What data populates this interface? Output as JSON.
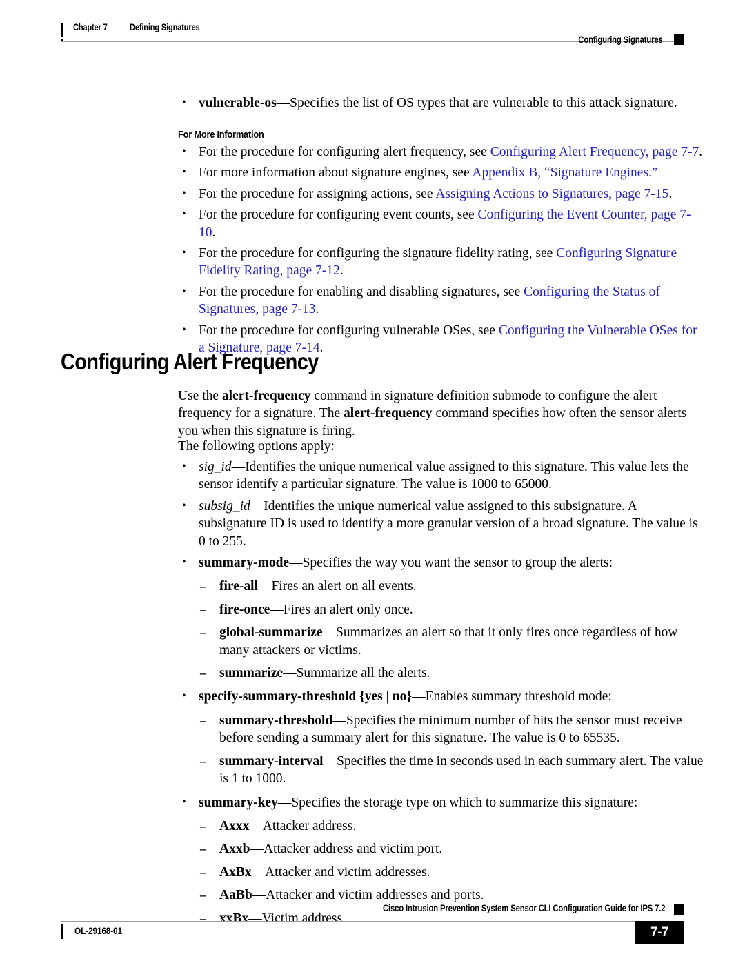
{
  "header": {
    "chapter_label": "Chapter 7",
    "chapter_title": "Defining Signatures",
    "section_label": "Configuring Signatures"
  },
  "footer": {
    "guide_title": "Cisco Intrusion Prevention System Sensor CLI Configuration Guide for IPS 7.2",
    "doc_id": "OL-29168-01",
    "page_number": "7-7"
  },
  "body": {
    "intro_bullet": {
      "term": "vulnerable-os",
      "text": "—Specifies the list of OS types that are vulnerable to this attack signature."
    },
    "for_more_information_heading": "For More Information",
    "for_more_information": [
      {
        "lead": "For the procedure for configuring alert frequency, see ",
        "link": "Configuring Alert Frequency, page 7-7",
        "tail": "."
      },
      {
        "lead": "For more information about signature engines, see ",
        "link": "Appendix B, “Signature Engines.”",
        "tail": ""
      },
      {
        "lead": "For the procedure for assigning actions, see ",
        "link": "Assigning Actions to Signatures, page 7-15",
        "tail": "."
      },
      {
        "lead": "For the procedure for configuring event counts, see ",
        "link": "Configuring the Event Counter, page 7-10",
        "tail": "."
      },
      {
        "lead": "For the procedure for configuring the signature fidelity rating, see ",
        "link": "Configuring Signature Fidelity Rating, page 7-12",
        "tail": "."
      },
      {
        "lead": "For the procedure for enabling and disabling signatures, see ",
        "link": "Configuring the Status of Signatures, page 7-13",
        "tail": "."
      },
      {
        "lead": "For the procedure for configuring vulnerable OSes, see ",
        "link": "Configuring the Vulnerable OSes for a Signature, page 7-14",
        "tail": "."
      }
    ],
    "section_heading": "Configuring Alert Frequency",
    "intro_paragraph": {
      "p1a": "Use the ",
      "cmd1": "alert-frequency",
      "p1b": " command in signature definition submode to configure the alert frequency for a signature. The ",
      "cmd2": "alert-frequency",
      "p1c": " command specifies how often the sensor alerts you when this signature is firing."
    },
    "options_intro": "The following options apply:",
    "options": [
      {
        "term": "sig_id",
        "term_style": "italic",
        "text": "—Identifies the unique numerical value assigned to this signature. This value lets the sensor identify a particular signature. The value is 1000 to 65000.",
        "children": []
      },
      {
        "term": "subsig_id",
        "term_style": "italic",
        "text": "—Identifies the unique numerical value assigned to this subsignature. A subsignature ID is used to identify a more granular version of a broad signature. The value is 0 to 255.",
        "children": []
      },
      {
        "term": "summary-mode",
        "term_style": "bold",
        "text": "—Specifies the way you want the sensor to group the alerts:",
        "children": [
          {
            "term": "fire-all",
            "text": "—Fires an alert on all events."
          },
          {
            "term": "fire-once",
            "text": "—Fires an alert only once."
          },
          {
            "term": "global-summarize",
            "text": "—Summarizes an alert so that it only fires once regardless of how many attackers or victims."
          },
          {
            "term": "summarize",
            "text": "—Summarize all the alerts."
          }
        ]
      },
      {
        "term": "specify-summary-threshold {yes | no}",
        "term_style": "bold",
        "text": "—Enables summary threshold mode:",
        "children": [
          {
            "term": "summary-threshold",
            "text": "—Specifies the minimum number of hits the sensor must receive before sending a summary alert for this signature. The value is 0 to 65535."
          },
          {
            "term": "summary-interval",
            "text": "—Specifies the time in seconds used in each summary alert. The value is 1 to 1000."
          }
        ]
      },
      {
        "term": "summary-key",
        "term_style": "bold",
        "text": "—Specifies the storage type on which to summarize this signature:",
        "children": [
          {
            "term": "Axxx",
            "text": "—Attacker address."
          },
          {
            "term": "Axxb",
            "text": "—Attacker address and victim port."
          },
          {
            "term": "AxBx",
            "text": "—Attacker and victim addresses."
          },
          {
            "term": "AaBb",
            "text": "—Attacker and victim addresses and ports."
          },
          {
            "term": "xxBx",
            "text": "—Victim address."
          }
        ]
      }
    ]
  },
  "colors": {
    "link": "#2222cc",
    "rule": "#9a9a9a",
    "text": "#000000"
  }
}
